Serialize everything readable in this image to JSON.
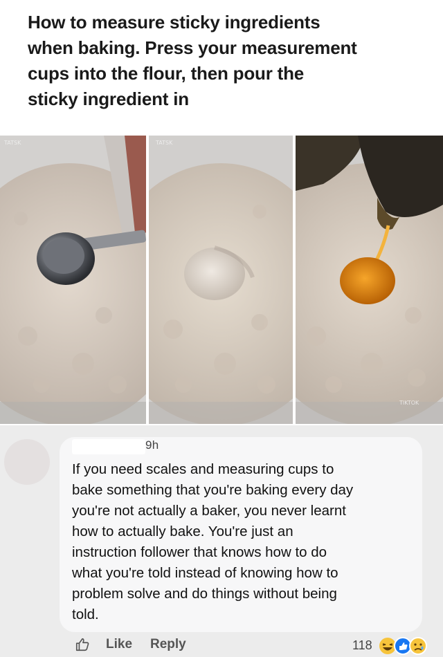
{
  "post": {
    "caption": "How to measure sticky ingredients\nwhen baking. Press your measurement\ncups into the flour, then pour the\nsticky ingredient in",
    "images": [
      {
        "watermark": "TATSK"
      },
      {
        "watermark": "TATSK"
      },
      {
        "watermark": "TIKTOK"
      }
    ]
  },
  "comment": {
    "timestamp": "9h",
    "text": "If you need scales and measuring cups to\nbake something that you're baking every day\nyou're not actually a baker, you never learnt\nhow to actually bake. You're just an\ninstruction follower that knows how to do\nwhat you're told instead of knowing how to\nproblem solve and do things without being\ntold.",
    "actions": {
      "like_label": "Like",
      "reply_label": "Reply",
      "reaction_count": "118"
    },
    "reactions": [
      "laugh-reaction-icon",
      "like-reaction-icon",
      "sad-reaction-icon"
    ]
  },
  "colors": {
    "flour": "#d8cec3",
    "honey": "#e48a0e",
    "bubble": "#f7f7f8",
    "like_blue": "#1877f2"
  }
}
